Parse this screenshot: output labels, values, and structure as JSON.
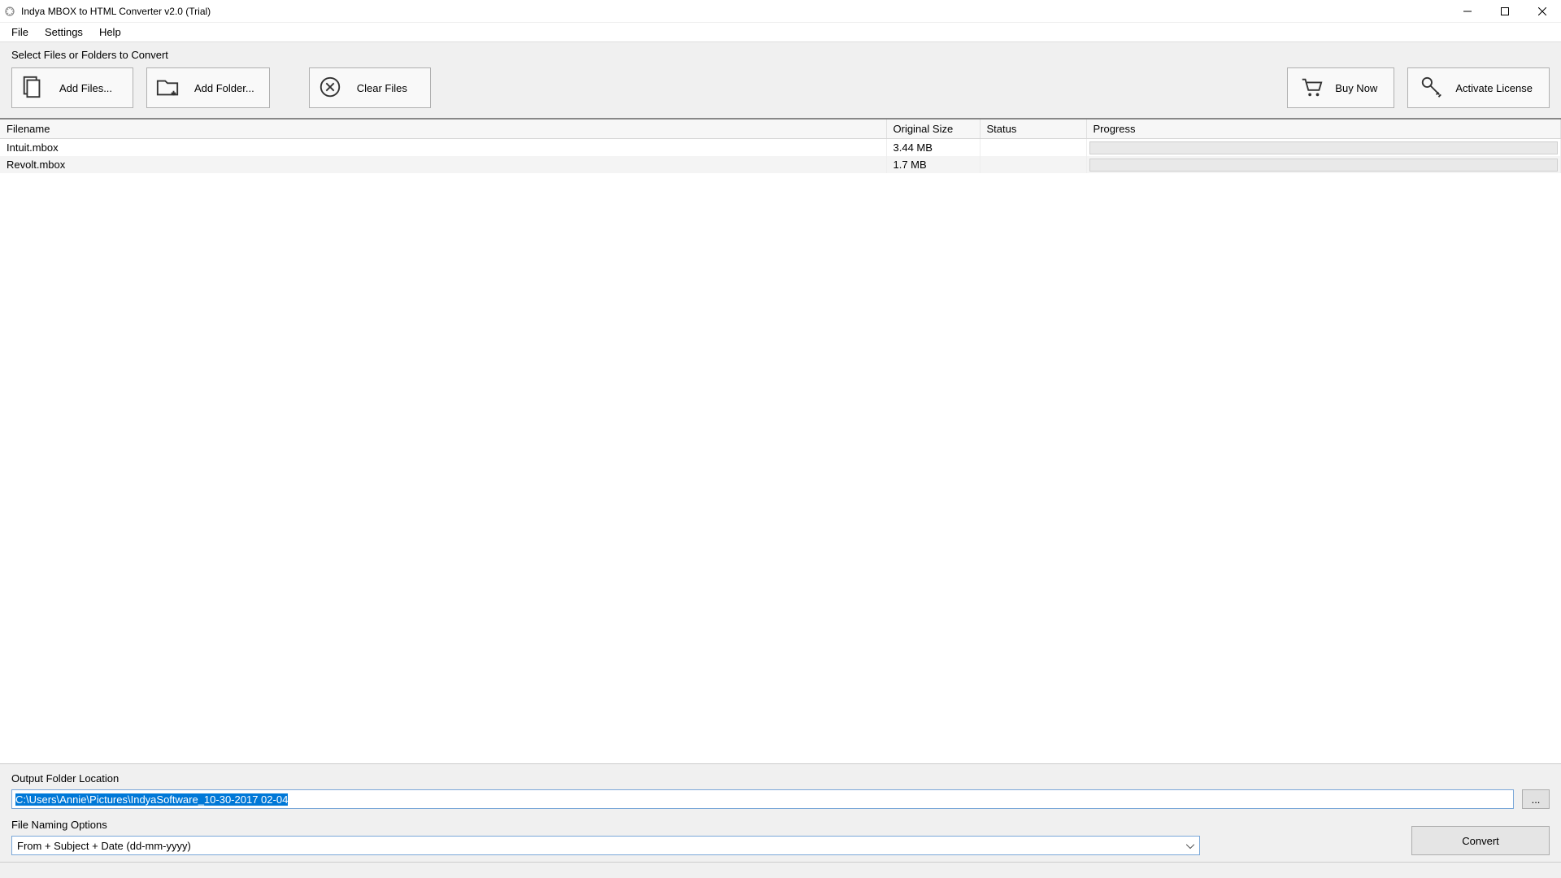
{
  "titlebar": {
    "title": "Indya MBOX to HTML Converter v2.0 (Trial)"
  },
  "menu": {
    "file": "File",
    "settings": "Settings",
    "help": "Help"
  },
  "toolbar": {
    "section_label": "Select Files or Folders to Convert",
    "add_files": "Add Files...",
    "add_folder": "Add Folder...",
    "clear_files": "Clear Files",
    "buy_now": "Buy Now",
    "activate": "Activate License"
  },
  "table": {
    "headers": {
      "filename": "Filename",
      "original_size": "Original Size",
      "status": "Status",
      "progress": "Progress"
    },
    "rows": [
      {
        "filename": "Intuit.mbox",
        "size": "3.44 MB",
        "status": ""
      },
      {
        "filename": "Revolt.mbox",
        "size": "1.7 MB",
        "status": ""
      }
    ]
  },
  "output": {
    "folder_label": "Output Folder Location",
    "folder_value": "C:\\Users\\Annie\\Pictures\\IndyaSoftware_10-30-2017 02-04",
    "browse_label": "...",
    "naming_label": "File Naming Options",
    "naming_value": "From + Subject + Date (dd-mm-yyyy)",
    "convert_label": "Convert"
  }
}
